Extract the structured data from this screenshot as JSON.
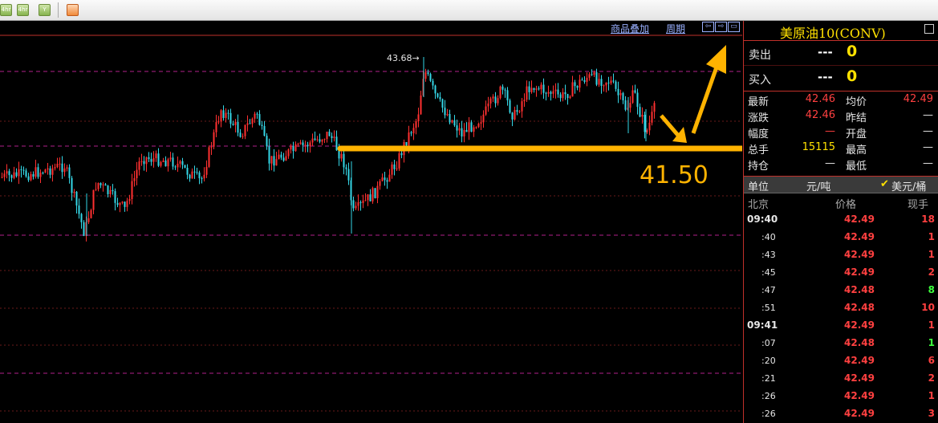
{
  "toolbar": {
    "buttons": [
      {
        "name": "toolbar-button-1",
        "label": "4hr"
      },
      {
        "name": "toolbar-button-2",
        "label": "4hr"
      },
      {
        "name": "toolbar-button-3",
        "label": "Y"
      }
    ]
  },
  "chart": {
    "link_overlay": "商品叠加",
    "link_period": "周期",
    "high_marker": "43.68→",
    "annotation_price": "41.50",
    "colors": {
      "up": "#ff3030",
      "down": "#35d6e6",
      "guide": "#ffb300",
      "grid": "#b0208a"
    }
  },
  "panel": {
    "title": "美原油10(CONV)",
    "sell": {
      "label": "卖出",
      "price": "---",
      "qty": "0"
    },
    "buy": {
      "label": "买入",
      "price": "---",
      "qty": "0"
    },
    "stats": {
      "latest_label": "最新",
      "latest": "42.46",
      "avg_label": "均价",
      "avg": "42.49",
      "change_label": "涨跌",
      "change": "42.46",
      "prev_label": "昨结",
      "prev": "—",
      "range_label": "幅度",
      "range": "—",
      "open_label": "开盘",
      "open": "—",
      "volume_label": "总手",
      "volume": "15115",
      "high_label": "最高",
      "high": "—",
      "oi_label": "持仓",
      "oi": "—",
      "low_label": "最低",
      "low": "—"
    },
    "unit": {
      "label": "单位",
      "value": "元/吨",
      "alt": "美元/桶"
    },
    "ticks_header": {
      "time": "北京",
      "price": "价格",
      "volume": "现手"
    },
    "ticks": [
      {
        "time": "09:40",
        "price": "42.49",
        "vol": "18",
        "dir": "up",
        "major": true
      },
      {
        "time": ":40",
        "price": "42.49",
        "vol": "1",
        "dir": "up",
        "major": false
      },
      {
        "time": ":43",
        "price": "42.49",
        "vol": "1",
        "dir": "up",
        "major": false
      },
      {
        "time": ":45",
        "price": "42.49",
        "vol": "2",
        "dir": "up",
        "major": false
      },
      {
        "time": ":47",
        "price": "42.48",
        "vol": "8",
        "dir": "down",
        "major": false
      },
      {
        "time": ":51",
        "price": "42.48",
        "vol": "10",
        "dir": "up",
        "major": false
      },
      {
        "time": "09:41",
        "price": "42.49",
        "vol": "1",
        "dir": "up",
        "major": true
      },
      {
        "time": ":07",
        "price": "42.48",
        "vol": "1",
        "dir": "down",
        "major": false
      },
      {
        "time": ":20",
        "price": "42.49",
        "vol": "6",
        "dir": "up",
        "major": false
      },
      {
        "time": ":21",
        "price": "42.49",
        "vol": "2",
        "dir": "up",
        "major": false
      },
      {
        "time": ":26",
        "price": "42.49",
        "vol": "1",
        "dir": "up",
        "major": false
      },
      {
        "time": ":26",
        "price": "42.49",
        "vol": "3",
        "dir": "up",
        "major": false
      }
    ]
  }
}
